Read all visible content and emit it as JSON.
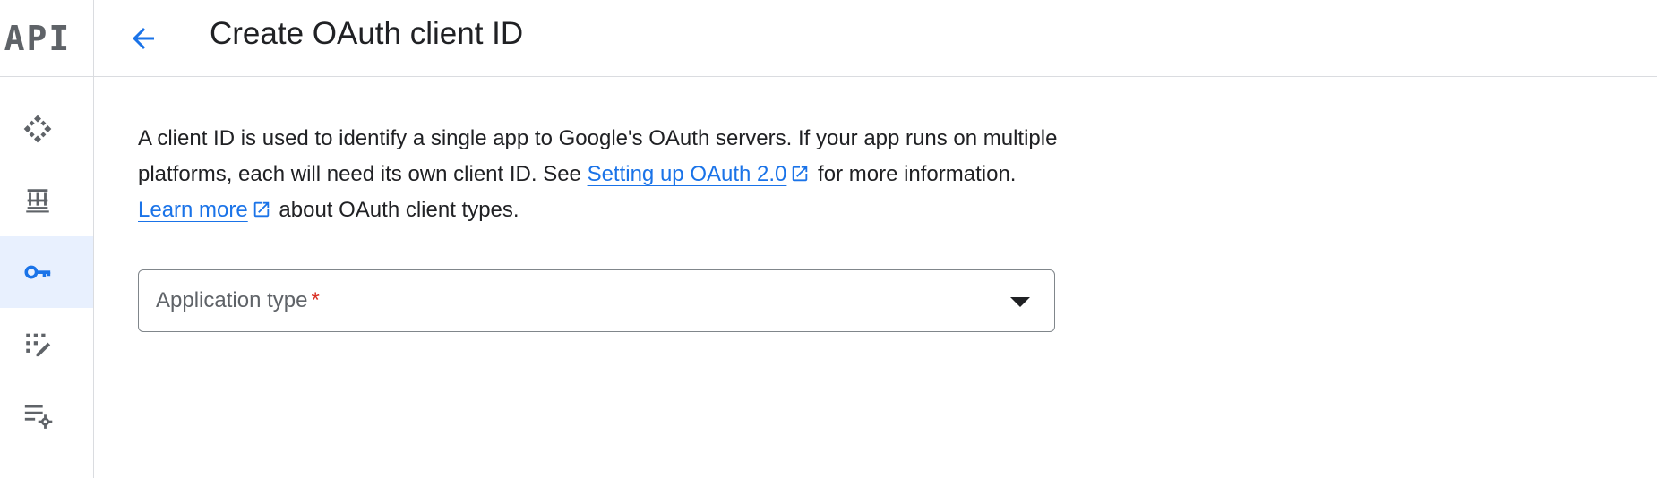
{
  "rail": {
    "logo_text": "API",
    "items": [
      {
        "icon": "services-diamond-icon",
        "active": false
      },
      {
        "icon": "library-icon",
        "active": false
      },
      {
        "icon": "key-icon",
        "active": true
      },
      {
        "icon": "consent-screen-icon",
        "active": false
      },
      {
        "icon": "page-settings-icon",
        "active": false
      }
    ]
  },
  "header": {
    "back_icon": "arrow-back-icon",
    "title": "Create OAuth client ID"
  },
  "main": {
    "intro": {
      "part1": "A client ID is used to identify a single app to Google's OAuth servers. If your app runs on multiple platforms, each will need its own client ID. See ",
      "link1": "Setting up OAuth 2.0",
      "part2": " for more information. ",
      "link2": "Learn more",
      "part3": " about OAuth client types."
    },
    "application_type": {
      "label": "Application type",
      "required_mark": "*",
      "selected": ""
    }
  },
  "colors": {
    "accent": "#1a73e8",
    "rail_active_bg": "#e8f0fe",
    "required": "#d93025",
    "border": "#dadce0"
  }
}
